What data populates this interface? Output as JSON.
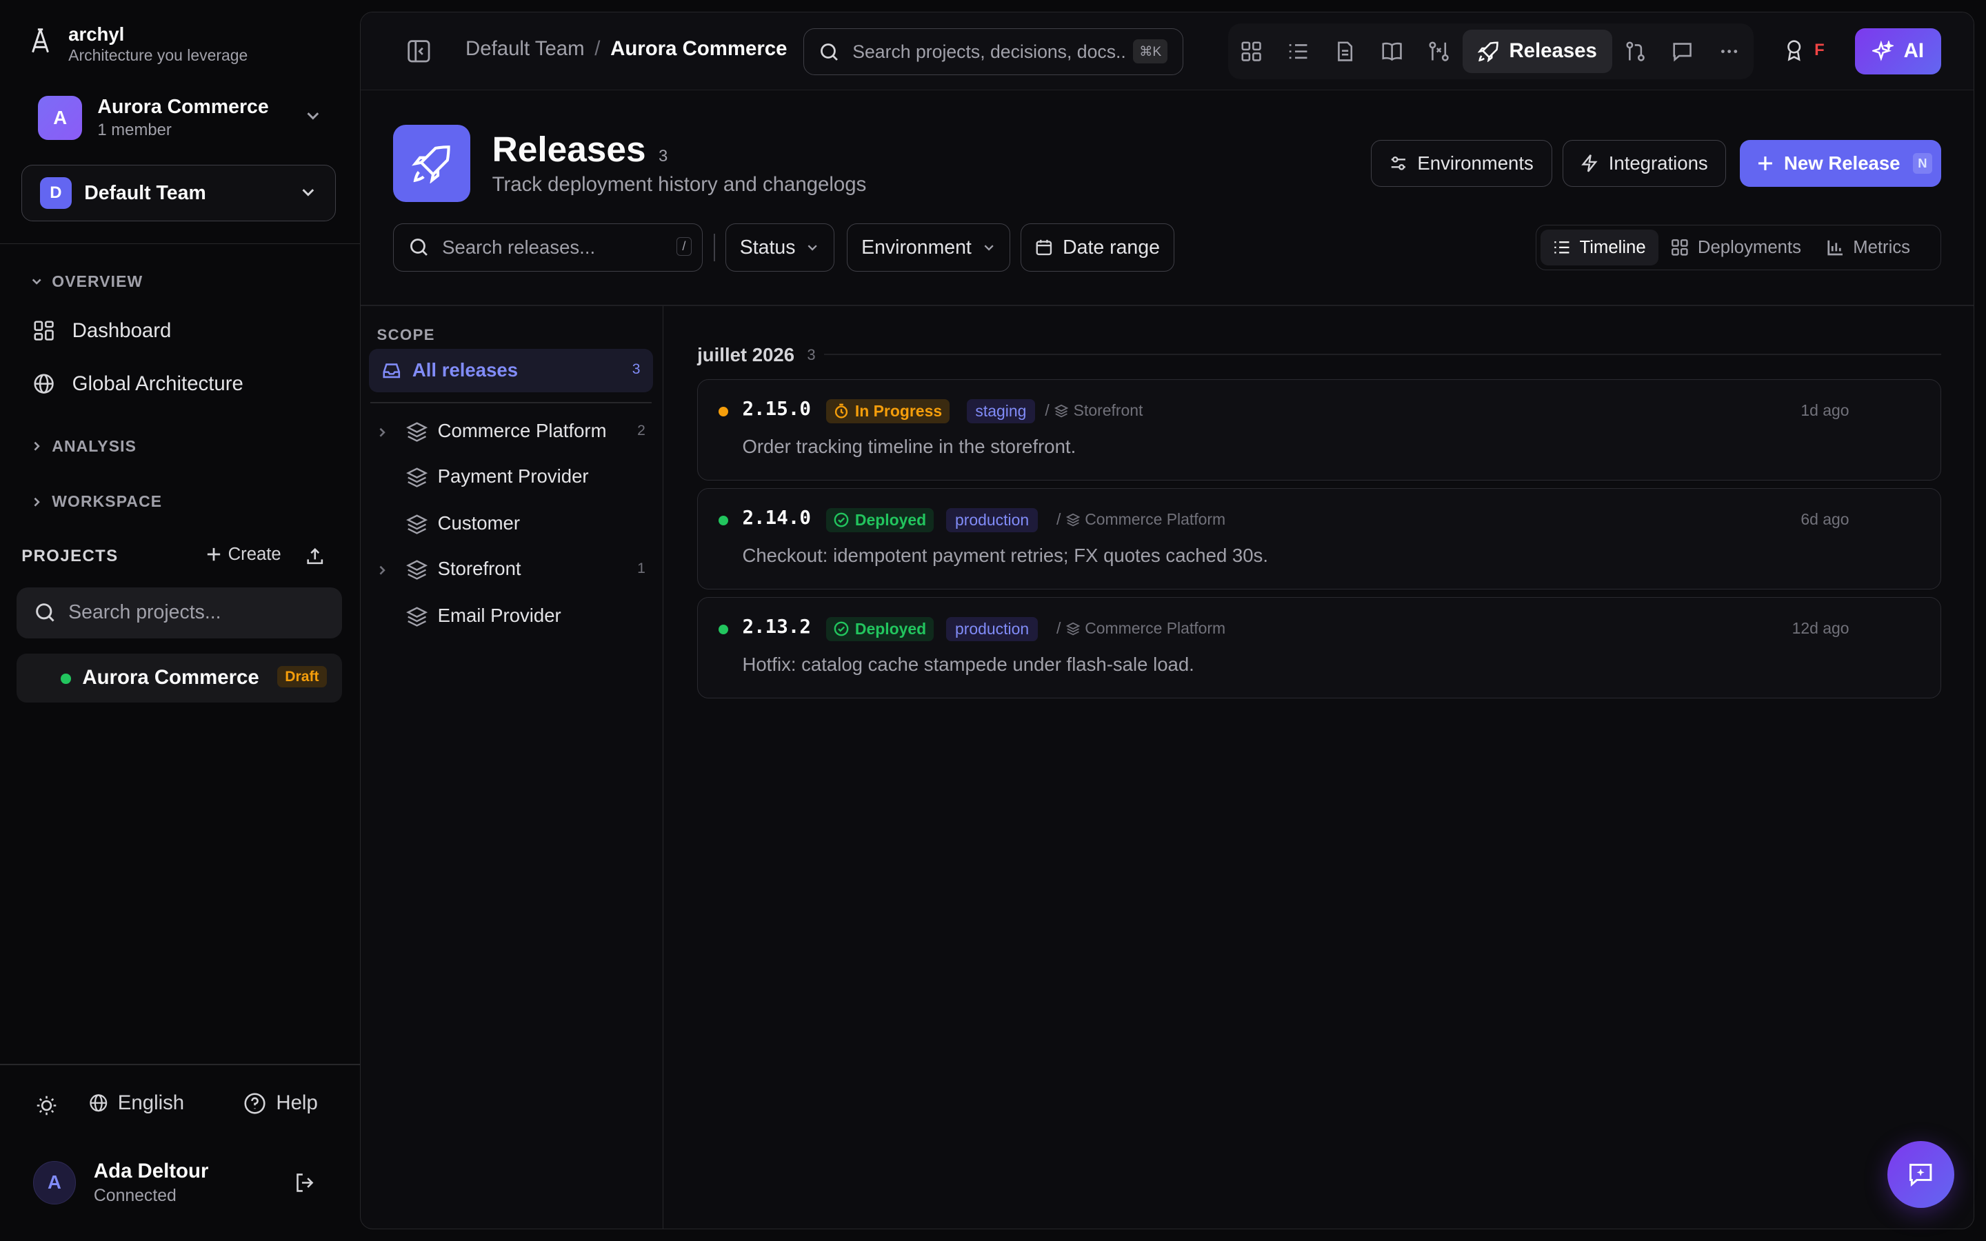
{
  "brand": {
    "name": "archyl",
    "tagline": "Architecture you leverage"
  },
  "project_switcher": {
    "avatar": "A",
    "title": "Aurora Commerce",
    "subtitle": "1 member"
  },
  "team_select": {
    "avatar": "D",
    "name": "Default Team"
  },
  "sidebar": {
    "overview_label": "OVERVIEW",
    "nav": [
      {
        "label": "Dashboard",
        "icon": "dashboard-icon"
      },
      {
        "label": "Global Architecture",
        "icon": "globe-icon"
      }
    ],
    "analysis_label": "ANALYSIS",
    "workspace_label": "WORKSPACE",
    "projects_label": "PROJECTS",
    "create_label": "Create",
    "search_placeholder": "Search projects...",
    "project": {
      "name": "Aurora Commerce",
      "badge": "Draft"
    },
    "language": "English",
    "help": "Help",
    "user": {
      "avatar": "A",
      "name": "Ada Deltour",
      "status": "Connected"
    }
  },
  "topbar": {
    "breadcrumb": [
      "Default Team",
      "Aurora Commerce"
    ],
    "breadcrumb_sep": "/",
    "search_placeholder": "Search projects, decisions, docs...",
    "search_kbd": "⌘K",
    "active_tool": "Releases",
    "award_label": "F",
    "ai_label": "AI"
  },
  "page": {
    "title": "Releases",
    "count": "3",
    "subtitle": "Track deployment history and changelogs",
    "environments_btn": "Environments",
    "integrations_btn": "Integrations",
    "new_release_btn": "New Release",
    "new_release_kbd": "N"
  },
  "filters": {
    "search_placeholder": "Search releases...",
    "search_kbd": "/",
    "status": "Status",
    "environment": "Environment",
    "date_range": "Date range",
    "views": [
      "Timeline",
      "Deployments",
      "Metrics"
    ]
  },
  "scope": {
    "label": "SCOPE",
    "all": {
      "label": "All releases",
      "count": "3"
    },
    "items": [
      {
        "name": "Commerce Platform",
        "count": "2",
        "expandable": true
      },
      {
        "name": "Payment Provider",
        "count": "",
        "expandable": false
      },
      {
        "name": "Customer",
        "count": "",
        "expandable": false
      },
      {
        "name": "Storefront",
        "count": "1",
        "expandable": true
      },
      {
        "name": "Email Provider",
        "count": "",
        "expandable": false
      }
    ]
  },
  "releases_group": {
    "month": "juillet 2026",
    "count": "3"
  },
  "releases": [
    {
      "version": "2.15.0",
      "status": "In Progress",
      "status_color": "#f59e0b",
      "env": "staging",
      "separator": "/",
      "component": "Storefront",
      "time": "1d ago",
      "description": "Order tracking timeline in the storefront."
    },
    {
      "version": "2.14.0",
      "status": "Deployed",
      "status_color": "#22c55e",
      "env": "production",
      "separator": "/",
      "component": "Commerce Platform",
      "time": "6d ago",
      "description": "Checkout: idempotent payment retries; FX quotes cached 30s."
    },
    {
      "version": "2.13.2",
      "status": "Deployed",
      "status_color": "#22c55e",
      "env": "production",
      "separator": "/",
      "component": "Commerce Platform",
      "time": "12d ago",
      "description": "Hotfix: catalog cache stampede under flash-sale load."
    }
  ],
  "colors": {
    "accent": "#6366f1",
    "accent_text": "#818cf8",
    "success": "#22c55e",
    "warning": "#f59e0b",
    "danger": "#ef4444"
  }
}
